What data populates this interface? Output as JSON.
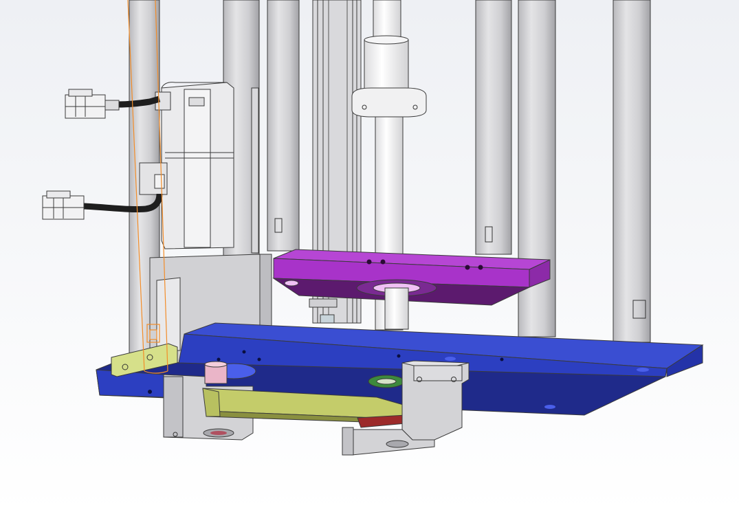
{
  "viewport": {
    "background_top": "#eef0f4",
    "background_bottom": "#ffffff"
  },
  "colors": {
    "rod": "#d4d4d6",
    "rod_shade": "#a9a9ad",
    "rod_edge": "#3a3a3a",
    "motor_body": "#e6e6e8",
    "motor_mount": "#cfcfd2",
    "top_plate": "#a833c9",
    "top_plate_side": "#5c1a6e",
    "base_plate": "#2c3fc1",
    "base_plate_side": "#1c2570",
    "belt_arm": "#c4cc6a",
    "bracket": "#d6e08a",
    "bearing_block": "#d0d0d3",
    "pulley_pink": "#eab5c8",
    "pulley_green": "#3d8a3d",
    "teeth": "#9c2a2a",
    "selection_outline": "#f28c28",
    "cable": "#1e1e1e"
  },
  "parts": [
    {
      "id": "guide-rods",
      "icon": "cylinder-icon"
    },
    {
      "id": "ball-screw",
      "icon": "screw-icon"
    },
    {
      "id": "linear-rail",
      "icon": "rail-icon"
    },
    {
      "id": "servo-motor",
      "icon": "motor-icon"
    },
    {
      "id": "connector-upper",
      "icon": "plug-icon"
    },
    {
      "id": "connector-lower",
      "icon": "plug-icon"
    },
    {
      "id": "top-plate",
      "icon": "plate-icon"
    },
    {
      "id": "base-plate",
      "icon": "plate-icon"
    },
    {
      "id": "belt-arm",
      "icon": "belt-icon"
    },
    {
      "id": "bearing-block",
      "icon": "block-icon"
    }
  ]
}
